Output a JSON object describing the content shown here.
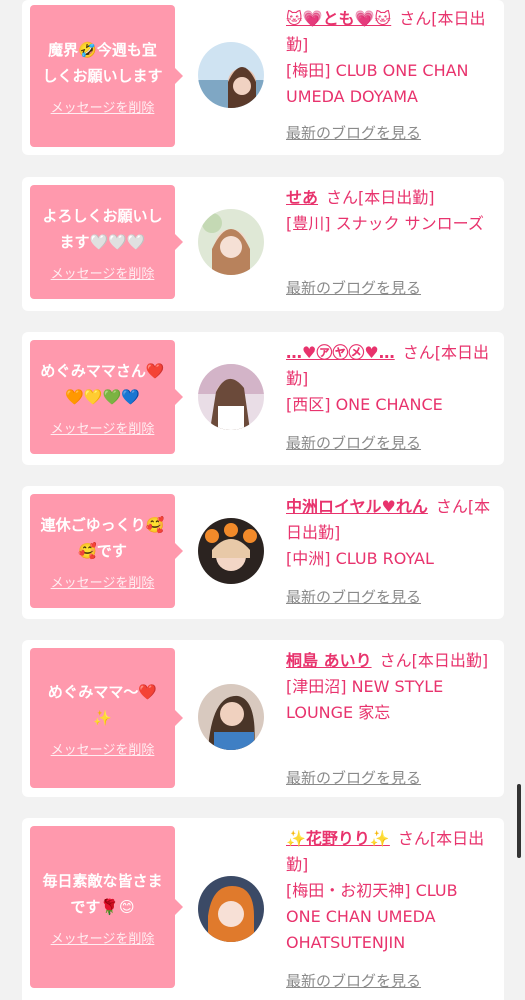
{
  "cards": [
    {
      "message": "魔界🤣今週も宜しくお願いします",
      "delete_label": "メッセージを削除",
      "name": "🐱💗とも💗🐱",
      "san_status": "さん[本日出勤]",
      "shop": "[梅田] CLUB ONE CHAN UMEDA DOYAMA",
      "blog_label": "最新のブログを見る"
    },
    {
      "message": "よろしくお願いします🤍🤍🤍",
      "delete_label": "メッセージを削除",
      "name": "せあ",
      "san_status": "さん[本日出勤]",
      "shop": "[豊川] スナック サンローズ",
      "blog_label": "最新のブログを見る"
    },
    {
      "message": "めぐみママさん❤️🧡💛💚💙",
      "delete_label": "メッセージを削除",
      "name": "…♥㋐㋳㋱♥…",
      "san_status": "さん[本日出勤]",
      "shop": "[西区] ONE CHANCE",
      "blog_label": "最新のブログを見る"
    },
    {
      "message": "連休ごゆっくり🥰🥰です",
      "delete_label": "メッセージを削除",
      "name": "中洲ロイヤル♥れん",
      "san_status": "さん[本日出勤]",
      "shop": "[中洲] CLUB ROYAL",
      "blog_label": "最新のブログを見る"
    },
    {
      "message": "めぐみママ〜❤️✨",
      "delete_label": "メッセージを削除",
      "name": "桐島 あいり",
      "san_status": "さん[本日出勤]",
      "shop": "[津田沼] NEW STYLE LOUNGE 家忘",
      "blog_label": "最新のブログを見る"
    },
    {
      "message": "毎日素敵な皆さまです🌹😊",
      "delete_label": "メッセージを削除",
      "name": "✨花野りり✨",
      "san_status": "さん[本日出勤]",
      "shop": "[梅田・お初天神] CLUB ONE CHAN UMEDA OHATSUTENJIN",
      "blog_label": "最新のブログを見る"
    }
  ],
  "colors": {
    "accent": "#e8336d",
    "bubble": "#ff99ad",
    "blog_link": "#8a8a8a"
  }
}
